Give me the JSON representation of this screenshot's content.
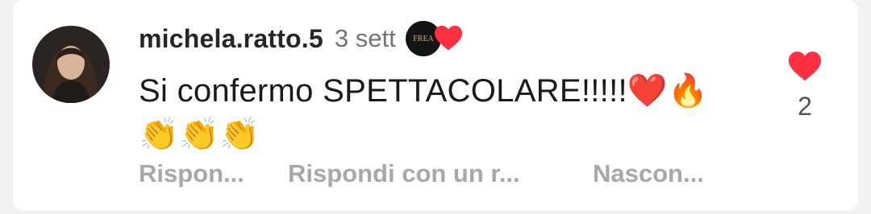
{
  "comment": {
    "username": "michela.ratto.5",
    "time": "3 sett",
    "creator_avatar_text": "FREA",
    "text": "Si confermo SPETTACOLARE!!!!!",
    "emojis": [
      "❤️",
      "🔥"
    ],
    "emojis_line2": [
      "👏",
      "👏",
      "👏"
    ],
    "like_count": "2"
  },
  "actions": {
    "reply": "Rispon...",
    "reply_with": "Rispondi con un r...",
    "hide": "Nascon..."
  },
  "colors": {
    "heart": "#ff3040",
    "secondary_text": "#737373",
    "action_text": "#a8a8a8"
  }
}
